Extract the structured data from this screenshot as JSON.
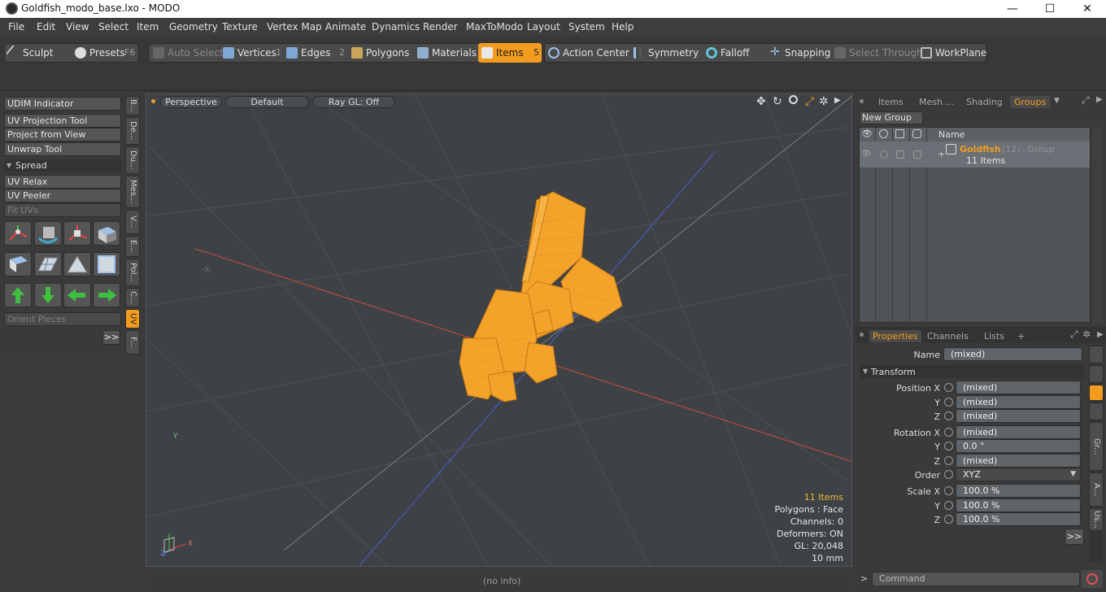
{
  "window": {
    "title": "Goldfish_modo_base.lxo - MODO",
    "minimize": "—",
    "maximize": "☐",
    "close": "✕"
  },
  "menu": [
    "File",
    "Edit",
    "View",
    "Select",
    "Item",
    "Geometry",
    "Texture",
    "Vertex Map",
    "Animate",
    "Dynamics",
    "Render",
    "MaxToModo",
    "Layout",
    "System",
    "Help"
  ],
  "toolbar": {
    "sculpt": "Sculpt",
    "presets": "Presets",
    "presets_key": "F6",
    "auto_select": "Auto Select",
    "vertices": "Vertices",
    "vertices_key": "1",
    "edges": "Edges",
    "edges_key": "2",
    "polygons": "Polygons",
    "materials": "Materials",
    "items": "Items",
    "items_key": "5",
    "action_center": "Action Center",
    "symmetry": "Symmetry",
    "falloff": "Falloff",
    "snapping": "Snapping",
    "select_through": "Select Through",
    "workplane": "WorkPlane"
  },
  "left": {
    "udim": "UDIM Indicator",
    "uv_projection": "UV Projection Tool",
    "project_from_view": "Project from View",
    "unwrap": "Unwrap Tool",
    "spread": "Spread",
    "uv_relax": "UV Relax",
    "uv_peeler": "UV Peeler",
    "fit_uvs": "Fit UVs",
    "orient_pieces": "Orient Pieces",
    "more": ">>",
    "tabs": [
      "B...",
      "De...",
      "Du...",
      "Mes...",
      "V...",
      "E...",
      "Pol...",
      "C...",
      "UV",
      "F..."
    ]
  },
  "viewport": {
    "perspective": "Perspective",
    "default": "Default",
    "raygl": "Ray GL: Off",
    "info_items": "11 Items",
    "info_polys": "Polygons : Face",
    "info_channels": "Channels: 0",
    "info_deformers": "Deformers: ON",
    "info_gl": "GL: 20,048",
    "info_scale": "10 mm",
    "axis_x": "X",
    "axis_y": "Y",
    "axis_z": "Z",
    "status": "(no info)"
  },
  "right": {
    "tabs": [
      "Items",
      "Mesh ...",
      "Shading",
      "Groups"
    ],
    "new_group": "New Group",
    "name_col": "Name",
    "group_name": "Goldfish",
    "group_count": "(12)",
    "group_type": ": Group",
    "group_items": "11 Items",
    "prop_tabs": [
      "Properties",
      "Channels",
      "Lists",
      "+"
    ],
    "name_label": "Name",
    "name_value": "(mixed)",
    "transform": "Transform",
    "pos_x_label": "Position X",
    "pos_x": "(mixed)",
    "pos_y": "(mixed)",
    "pos_z": "(mixed)",
    "rot_x_label": "Rotation X",
    "rot_x": "(mixed)",
    "rot_y": "0.0 °",
    "rot_z": "(mixed)",
    "order_label": "Order",
    "order_value": "XYZ",
    "scale_x_label": "Scale X",
    "scale_x": "100.0 %",
    "scale_y": "100.0 %",
    "scale_z": "100.0 %",
    "y": "Y",
    "z": "Z",
    "side_tabs": [
      "Gr...",
      "A...",
      "Us..."
    ],
    "more": ">>",
    "command": "Command",
    "prompt": ">"
  },
  "colors": {
    "accent": "#f29c1f",
    "viewport_bg": "#3e4246",
    "panel": "#3a3a3a"
  }
}
